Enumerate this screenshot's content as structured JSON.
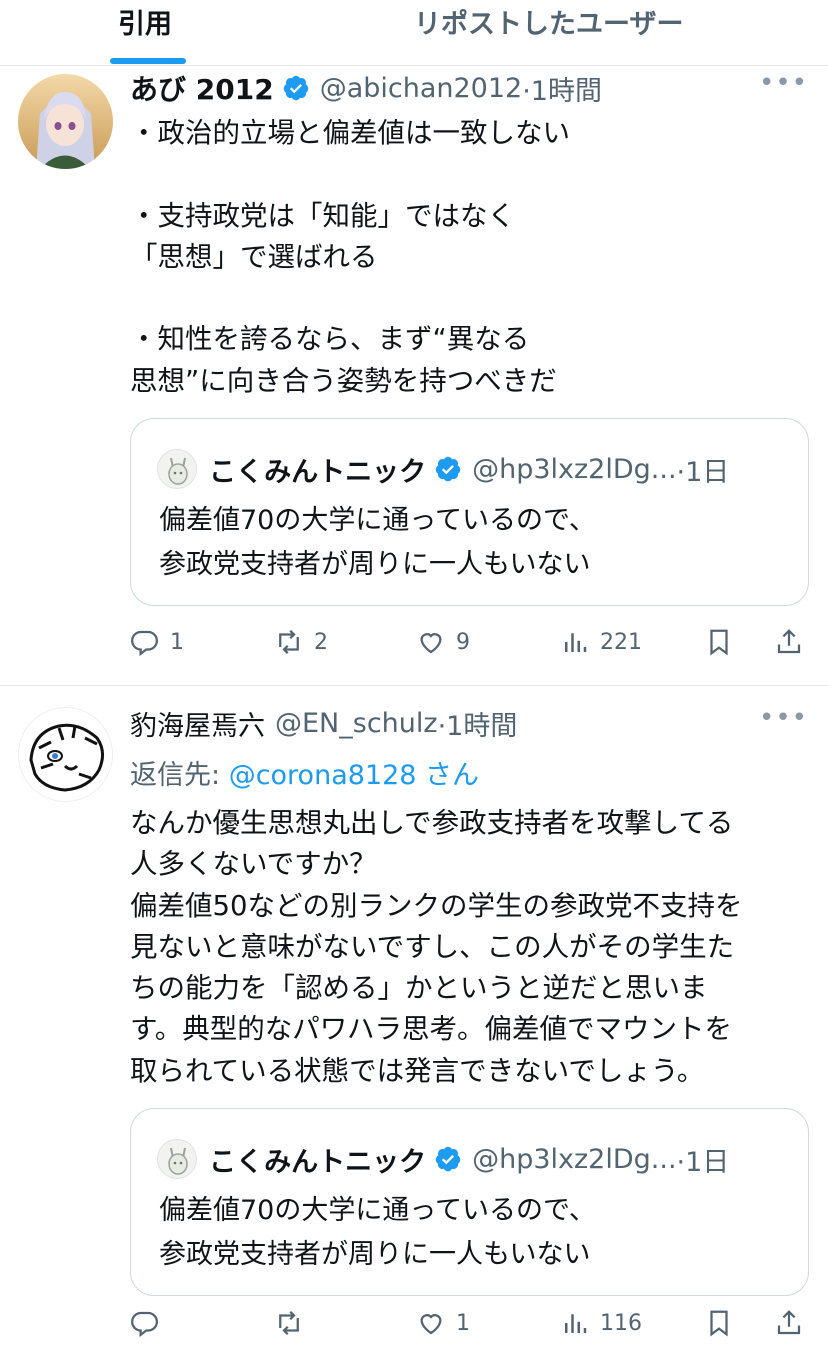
{
  "tabs": {
    "quotes": "引用",
    "reposts": "リポストしたユーザー"
  },
  "tweets": [
    {
      "name": "あび 2012",
      "handle": "@abichan2012",
      "time": "·1時間",
      "lines": [
        "・政治的立場と偏差値は一致しない",
        "",
        "・支持政党は「知能」ではなく",
        "「思想」で選ばれる",
        "",
        "・知性を誇るなら、まず“異なる",
        "思想”に向き合う姿勢を持つべきだ"
      ],
      "quote": {
        "name": "こくみんトニック",
        "handle": "@hp3lxz2lDg...",
        "time": "·1日",
        "lines": [
          "偏差値70の大学に通っているので、",
          "参政党支持者が周りに一人もいない"
        ]
      },
      "stats": {
        "replies": "1",
        "reposts": "2",
        "likes": "9",
        "views": "221"
      }
    },
    {
      "name": "豹海屋焉六",
      "handle": "@EN_schulz",
      "time": "·1時間",
      "reply_prefix": "返信先: ",
      "reply_mention": "@corona8128",
      "reply_suffix": " さん",
      "lines": [
        "なんか優生思想丸出しで参政支持者を攻撃してる",
        "人多くないですか？",
        "偏差値50などの別ランクの学生の参政党不支持を",
        "見ないと意味がないですし、この人がその学生た",
        "ちの能力を「認める」かというと逆だと思いま",
        "す。典型的なパワハラ思考。偏差値でマウントを",
        "取られている状態では発言できないでしょう。"
      ],
      "quote": {
        "name": "こくみんトニック",
        "handle": "@hp3lxz2lDg...",
        "time": "·1日",
        "lines": [
          "偏差値70の大学に通っているので、",
          "参政党支持者が周りに一人もいない"
        ]
      },
      "stats": {
        "replies": "",
        "reposts": "",
        "likes": "1",
        "views": "116"
      }
    }
  ],
  "icons": {
    "more": "more-icon",
    "verified": "verified-badge-icon",
    "reply": "reply-icon",
    "repost": "repost-icon",
    "like": "like-icon",
    "views": "views-icon",
    "bookmark": "bookmark-icon",
    "share": "share-icon"
  },
  "colors": {
    "accent": "#1d9bf0",
    "text": "#0f1419",
    "secondary": "#536471",
    "border": "#cfd9de"
  }
}
